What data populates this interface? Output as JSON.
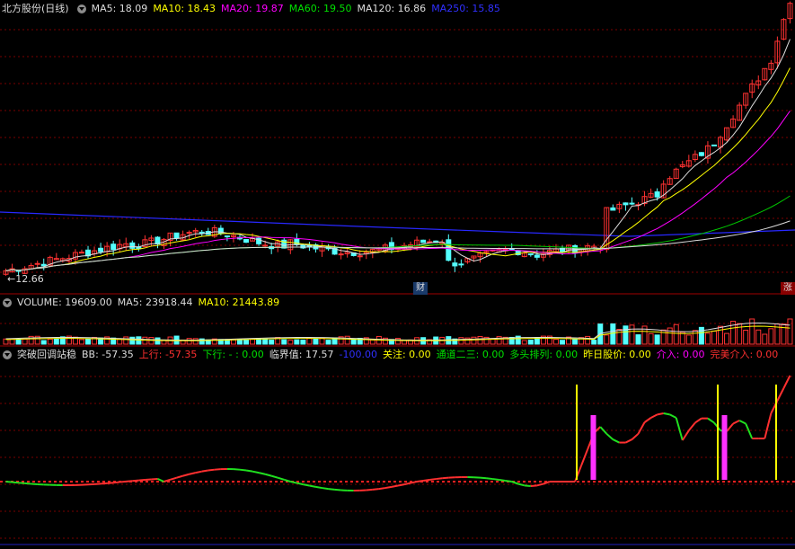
{
  "panel1": {
    "name": "北方股份(日线)",
    "name_color": "#dcdcdc",
    "ma": [
      {
        "label": "MA5: 18.09",
        "color": "#dcdcdc"
      },
      {
        "label": "MA10: 18.43",
        "color": "#ffff00"
      },
      {
        "label": "MA20: 19.87",
        "color": "#ff00ff"
      },
      {
        "label": "MA60: 19.50",
        "color": "#00e000"
      },
      {
        "label": "MA120: 16.86",
        "color": "#dcdcdc"
      },
      {
        "label": "MA250: 15.85",
        "color": "#3030ff"
      }
    ],
    "low_label": "←12.66",
    "cai_badge": "财",
    "zhang_badge": "涨"
  },
  "panel2": {
    "items": [
      {
        "label": "VOLUME: 19609.00",
        "color": "#dcdcdc"
      },
      {
        "label": "MA5: 23918.44",
        "color": "#dcdcdc"
      },
      {
        "label": "MA10: 21443.89",
        "color": "#ffff00"
      }
    ]
  },
  "panel3": {
    "items": [
      {
        "label": "突破回调站稳",
        "color": "#dcdcdc"
      },
      {
        "label": "BB: -57.35",
        "color": "#dcdcdc"
      },
      {
        "label": "上行: -57.35",
        "color": "#ff3030"
      },
      {
        "label": "下行: - : 0.00",
        "color": "#00e000"
      },
      {
        "label": "临界值: 17.57",
        "color": "#dcdcdc"
      },
      {
        "label": "-100.00",
        "color": "#3030ff"
      },
      {
        "label": "关注: 0.00",
        "color": "#ffff00"
      },
      {
        "label": "通道二三: 0.00",
        "color": "#00e000"
      },
      {
        "label": "多头排列: 0.00",
        "color": "#00e000"
      },
      {
        "label": "昨日股价: 0.00",
        "color": "#ffff00"
      },
      {
        "label": "介入: 0.00",
        "color": "#ff00ff"
      },
      {
        "label": "完美介入: 0.00",
        "color": "#ff3030"
      }
    ]
  },
  "colors": {
    "up": "#ff3232",
    "down": "#54ffff",
    "grid": "#7a0000",
    "sep": "#a00000"
  },
  "chart_data": [
    {
      "type": "candlestick",
      "title": "北方股份(日线)",
      "price_range": [
        12.0,
        27.5
      ],
      "annotations": [
        "←12.66"
      ],
      "note": "price trend: flat ~14-15 for ~100 sessions, then breakout to ~27"
    },
    {
      "type": "bar",
      "title": "VOLUME",
      "values_summary": {
        "VOLUME": 19609.0,
        "MA5": 23918.44,
        "MA10": 21443.89
      }
    },
    {
      "type": "line",
      "title": "突破回调站稳",
      "series": [
        {
          "name": "BB",
          "last": -57.35
        }
      ],
      "ylim": [
        -120,
        40
      ]
    }
  ]
}
